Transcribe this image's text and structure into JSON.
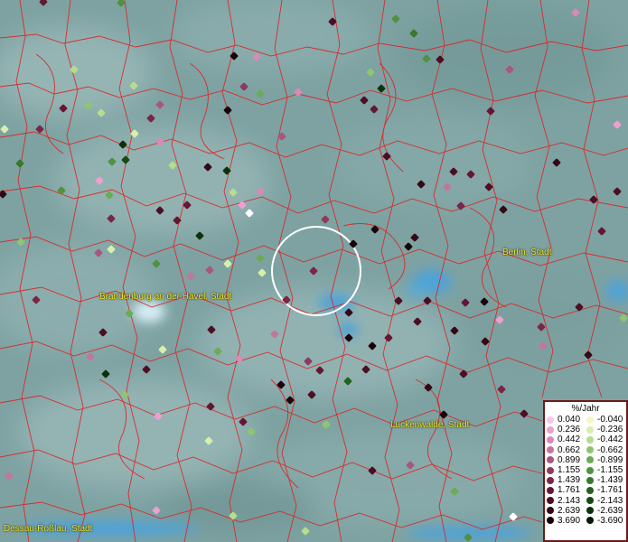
{
  "map": {
    "labels": [
      {
        "id": "berlin",
        "text": "Berlin, Stadt"
      },
      {
        "id": "brandenburg",
        "text": "Brandenburg an der Havel, Stadt"
      },
      {
        "id": "luckenwalde",
        "text": "Luckenwalde, Stadt"
      },
      {
        "id": "dessau",
        "text": "Dessau-Roßlau, Stadt"
      }
    ],
    "selection_circle": true
  },
  "legend": {
    "title": "%/Jahr",
    "positive": [
      {
        "value": "0.040",
        "color": "#f7c6ea"
      },
      {
        "value": "0.236",
        "color": "#ee9fd0"
      },
      {
        "value": "0.442",
        "color": "#d98ab8"
      },
      {
        "value": "0.662",
        "color": "#c4759d"
      },
      {
        "value": "0.899",
        "color": "#a8577e"
      },
      {
        "value": "1.155",
        "color": "#8e3a5e"
      },
      {
        "value": "1.439",
        "color": "#7a2646"
      },
      {
        "value": "1.761",
        "color": "#651633"
      },
      {
        "value": "2.143",
        "color": "#4d0d22"
      },
      {
        "value": "2.639",
        "color": "#340815"
      },
      {
        "value": "3.690",
        "color": "#1a0308"
      }
    ],
    "negative": [
      {
        "value": "-0.040",
        "color": "#f4f9c4"
      },
      {
        "value": "-0.236",
        "color": "#d8efaa"
      },
      {
        "value": "-0.442",
        "color": "#b4dd8c"
      },
      {
        "value": "-0.662",
        "color": "#8ec670"
      },
      {
        "value": "-0.899",
        "color": "#6cab55"
      },
      {
        "value": "-1.155",
        "color": "#4f923f"
      },
      {
        "value": "-1.439",
        "color": "#377a2c"
      },
      {
        "value": "-1.761",
        "color": "#24621d"
      },
      {
        "value": "-2.143",
        "color": "#154a12"
      },
      {
        "value": "-2.639",
        "color": "#0b320a"
      },
      {
        "value": "-3.690",
        "color": "#051b05"
      }
    ]
  }
}
